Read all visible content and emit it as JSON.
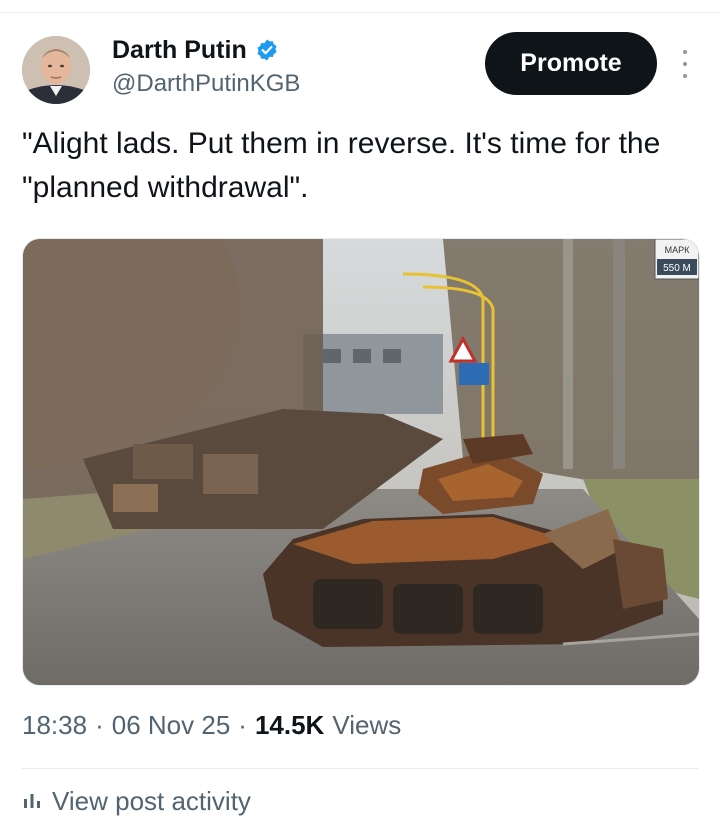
{
  "author": {
    "display_name": "Darth Putin",
    "handle": "@DarthPutinKGB",
    "verified_icon": "verified-badge-icon",
    "badge_color": "#1d9bf0"
  },
  "actions": {
    "promote_label": "Promote",
    "more_icon": "more-vertical-icon"
  },
  "tweet": {
    "text": "\"Alight lads. Put them in reverse. It's time for the \"planned withdrawal\".",
    "time": "18:38",
    "date": "06 Nov 25",
    "views_count": "14.5K",
    "views_label": "Views",
    "separator": "·"
  },
  "media": {
    "image_icon": "photo-destroyed-armored-vehicles",
    "sign_text": "МАРК",
    "sign_subtext": "550 М"
  },
  "footer": {
    "activity_label": "View post activity",
    "activity_icon": "bar-chart-icon"
  }
}
